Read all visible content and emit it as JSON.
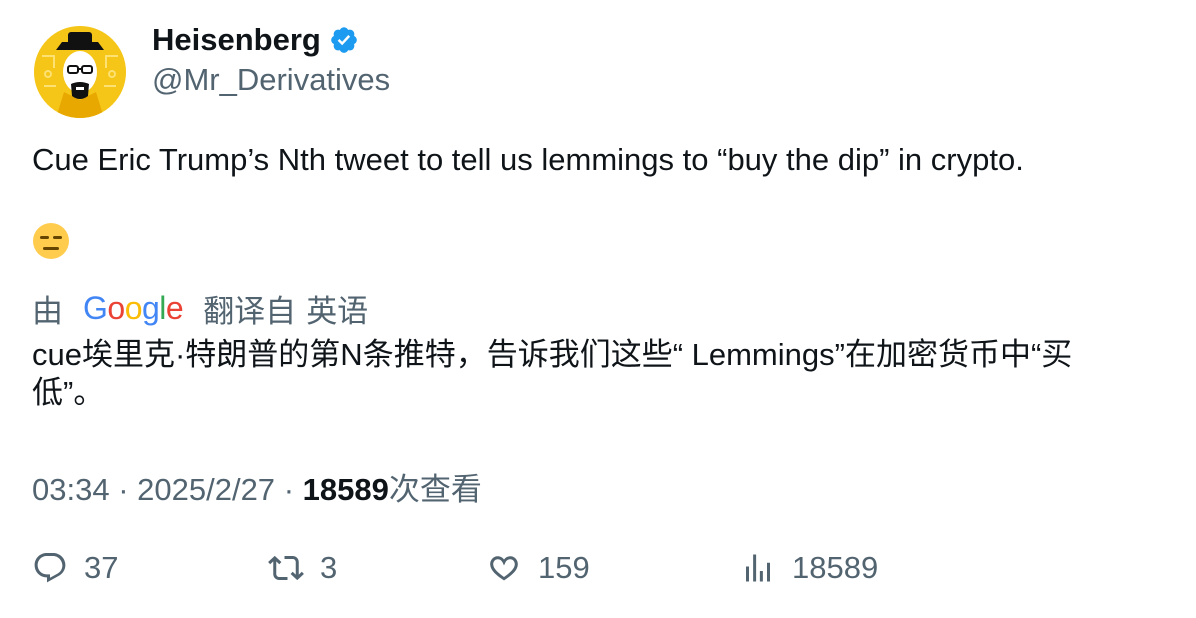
{
  "author": {
    "name": "Heisenberg",
    "handle": "@Mr_Derivatives",
    "verified": true,
    "avatar_icon": "heisenberg-avatar-icon"
  },
  "tweet": {
    "text": "Cue Eric Trump’s Nth tweet to tell us lemmings to “buy the dip” in crypto.",
    "emoji": "expressionless-face-emoji"
  },
  "translation": {
    "by_label": "由",
    "provider": "Google",
    "from_label": "翻译自",
    "language": "英语",
    "text": "cue埃里克·特朗普的第N条推特，告诉我们这些“ Lemmings”在加密货币中“买低”。"
  },
  "meta": {
    "time": "03:34",
    "date": "2025/2/27",
    "views_count": "18589",
    "views_label": "次查看"
  },
  "actions": {
    "replies": "37",
    "reposts": "3",
    "likes": "159",
    "views": "18589"
  },
  "colors": {
    "text": "#0f1419",
    "secondary": "#536471",
    "verified": "#1d9bf0",
    "avatar_bg": "#f5c518"
  }
}
